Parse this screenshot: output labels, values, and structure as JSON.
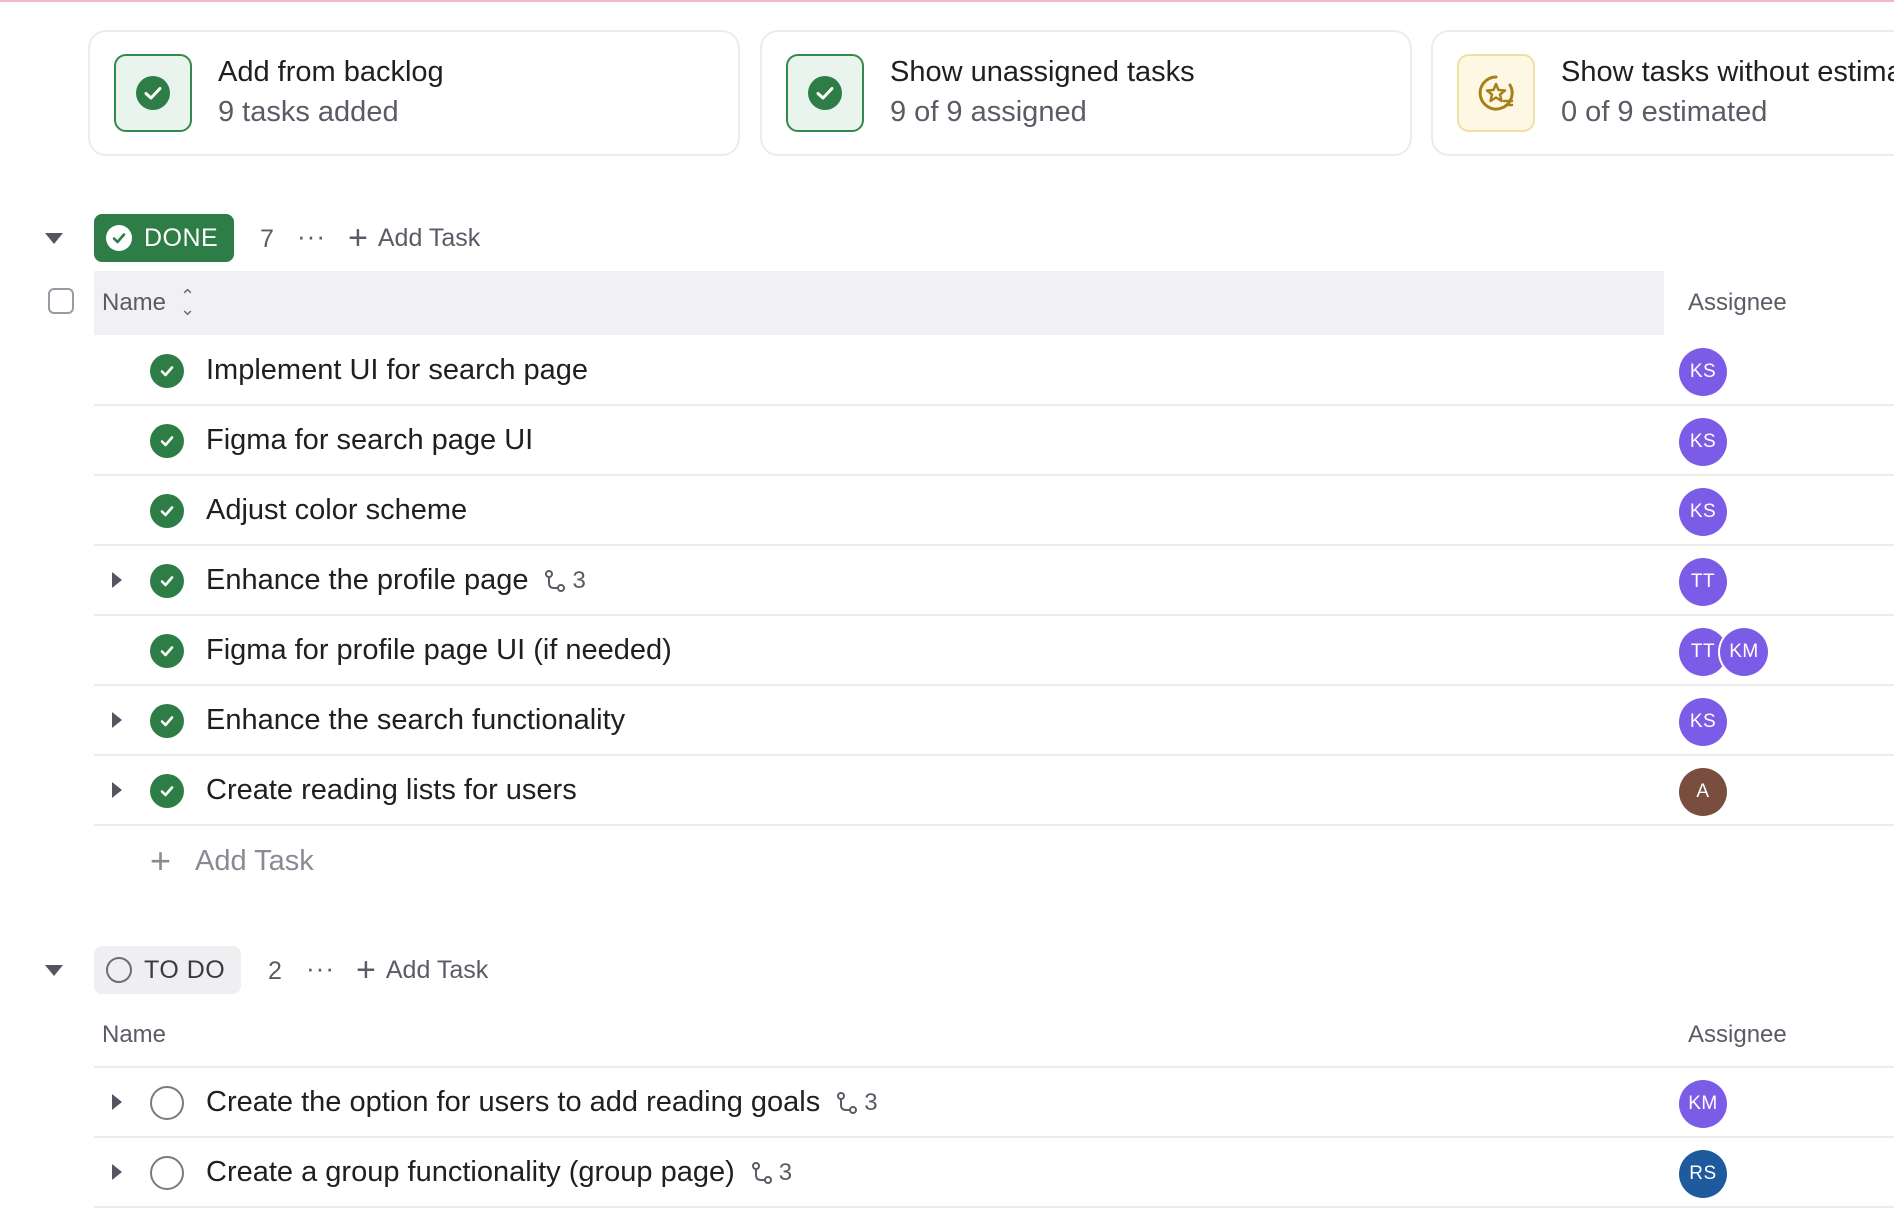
{
  "cards": [
    {
      "title": "Add from backlog",
      "subtitle": "9 tasks added",
      "icon": "check-circle-icon"
    },
    {
      "title": "Show unassigned tasks",
      "subtitle": "9 of 9 assigned",
      "icon": "check-circle-icon"
    },
    {
      "title": "Show tasks without estimat",
      "subtitle": "0 of 9 estimated",
      "icon": "star-badge-icon"
    }
  ],
  "groups": {
    "done": {
      "label": "DONE",
      "count": "7",
      "more": "···",
      "add_label": "Add Task",
      "columns": {
        "name": "Name",
        "assignee": "Assignee"
      },
      "tasks": [
        {
          "name": "Implement UI for search page",
          "assignees": [
            "KS"
          ]
        },
        {
          "name": "Figma for search page UI",
          "assignees": [
            "KS"
          ]
        },
        {
          "name": "Adjust color scheme",
          "assignees": [
            "KS"
          ]
        },
        {
          "name": "Enhance the profile page",
          "subtasks": "3",
          "assignees": [
            "TT"
          ]
        },
        {
          "name": "Figma for profile page UI (if needed)",
          "assignees": [
            "TT",
            "KM"
          ]
        },
        {
          "name": "Enhance the search functionality",
          "assignees": [
            "KS"
          ]
        },
        {
          "name": "Create reading lists for users",
          "assignees": [
            "A"
          ]
        }
      ],
      "add_row_label": "Add Task"
    },
    "todo": {
      "label": "TO DO",
      "count": "2",
      "more": "···",
      "add_label": "Add Task",
      "columns": {
        "name": "Name",
        "assignee": "Assignee"
      },
      "tasks": [
        {
          "name": "Create the option for users to add reading goals",
          "subtasks": "3",
          "assignees": [
            "KM"
          ]
        },
        {
          "name": "Create a group functionality (group page)",
          "subtasks": "3",
          "assignees": [
            "RS"
          ]
        }
      ]
    }
  },
  "colors": {
    "done_green": "#2e7d46",
    "avatar_purple": "#7b5ce6",
    "avatar_brown": "#7a4e3e",
    "avatar_blue": "#1f5a9e"
  }
}
